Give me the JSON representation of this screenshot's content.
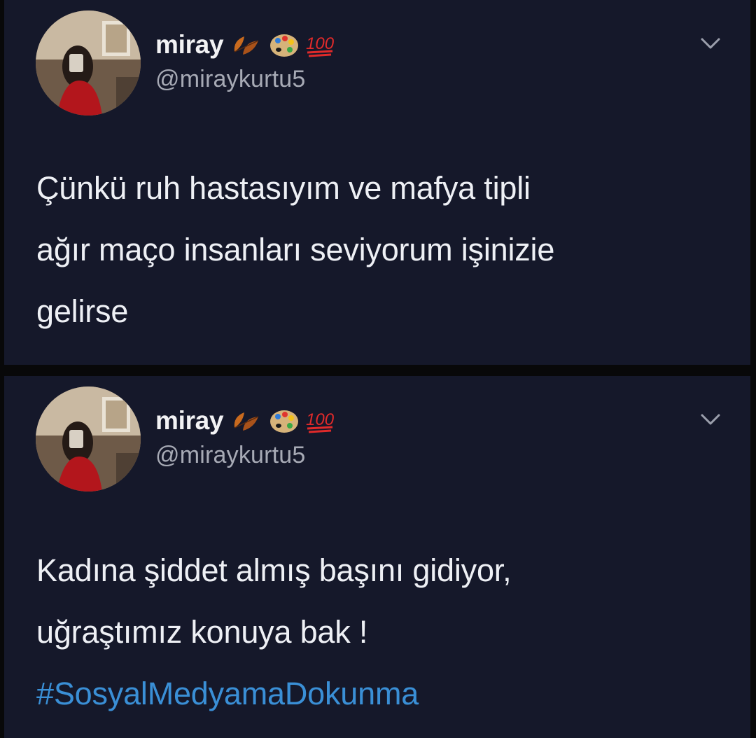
{
  "tweets": [
    {
      "author": {
        "display_name": "miray",
        "handle": "@miraykurtu5",
        "emojis": [
          "fallen-leaf-emoji",
          "artist-palette-emoji",
          "hundred-points-emoji"
        ]
      },
      "lines": [
        "Çünkü ruh hastasıyım ve mafya tipli",
        "ağır maço insanları seviyorum işinizie",
        "gelirse"
      ]
    },
    {
      "author": {
        "display_name": "miray",
        "handle": "@miraykurtu5",
        "emojis": [
          "fallen-leaf-emoji",
          "artist-palette-emoji",
          "hundred-points-emoji"
        ]
      },
      "lines": [
        "Kadına şiddet almış başını gidiyor,",
        "uğraştımız konuya bak !"
      ],
      "hashtag": "#SosyalMedyamaDokunma"
    }
  ],
  "colors": {
    "card_background": "#15182a",
    "text": "#eef0f5",
    "handle": "#a7aab5",
    "hashtag": "#3a8fd6"
  }
}
